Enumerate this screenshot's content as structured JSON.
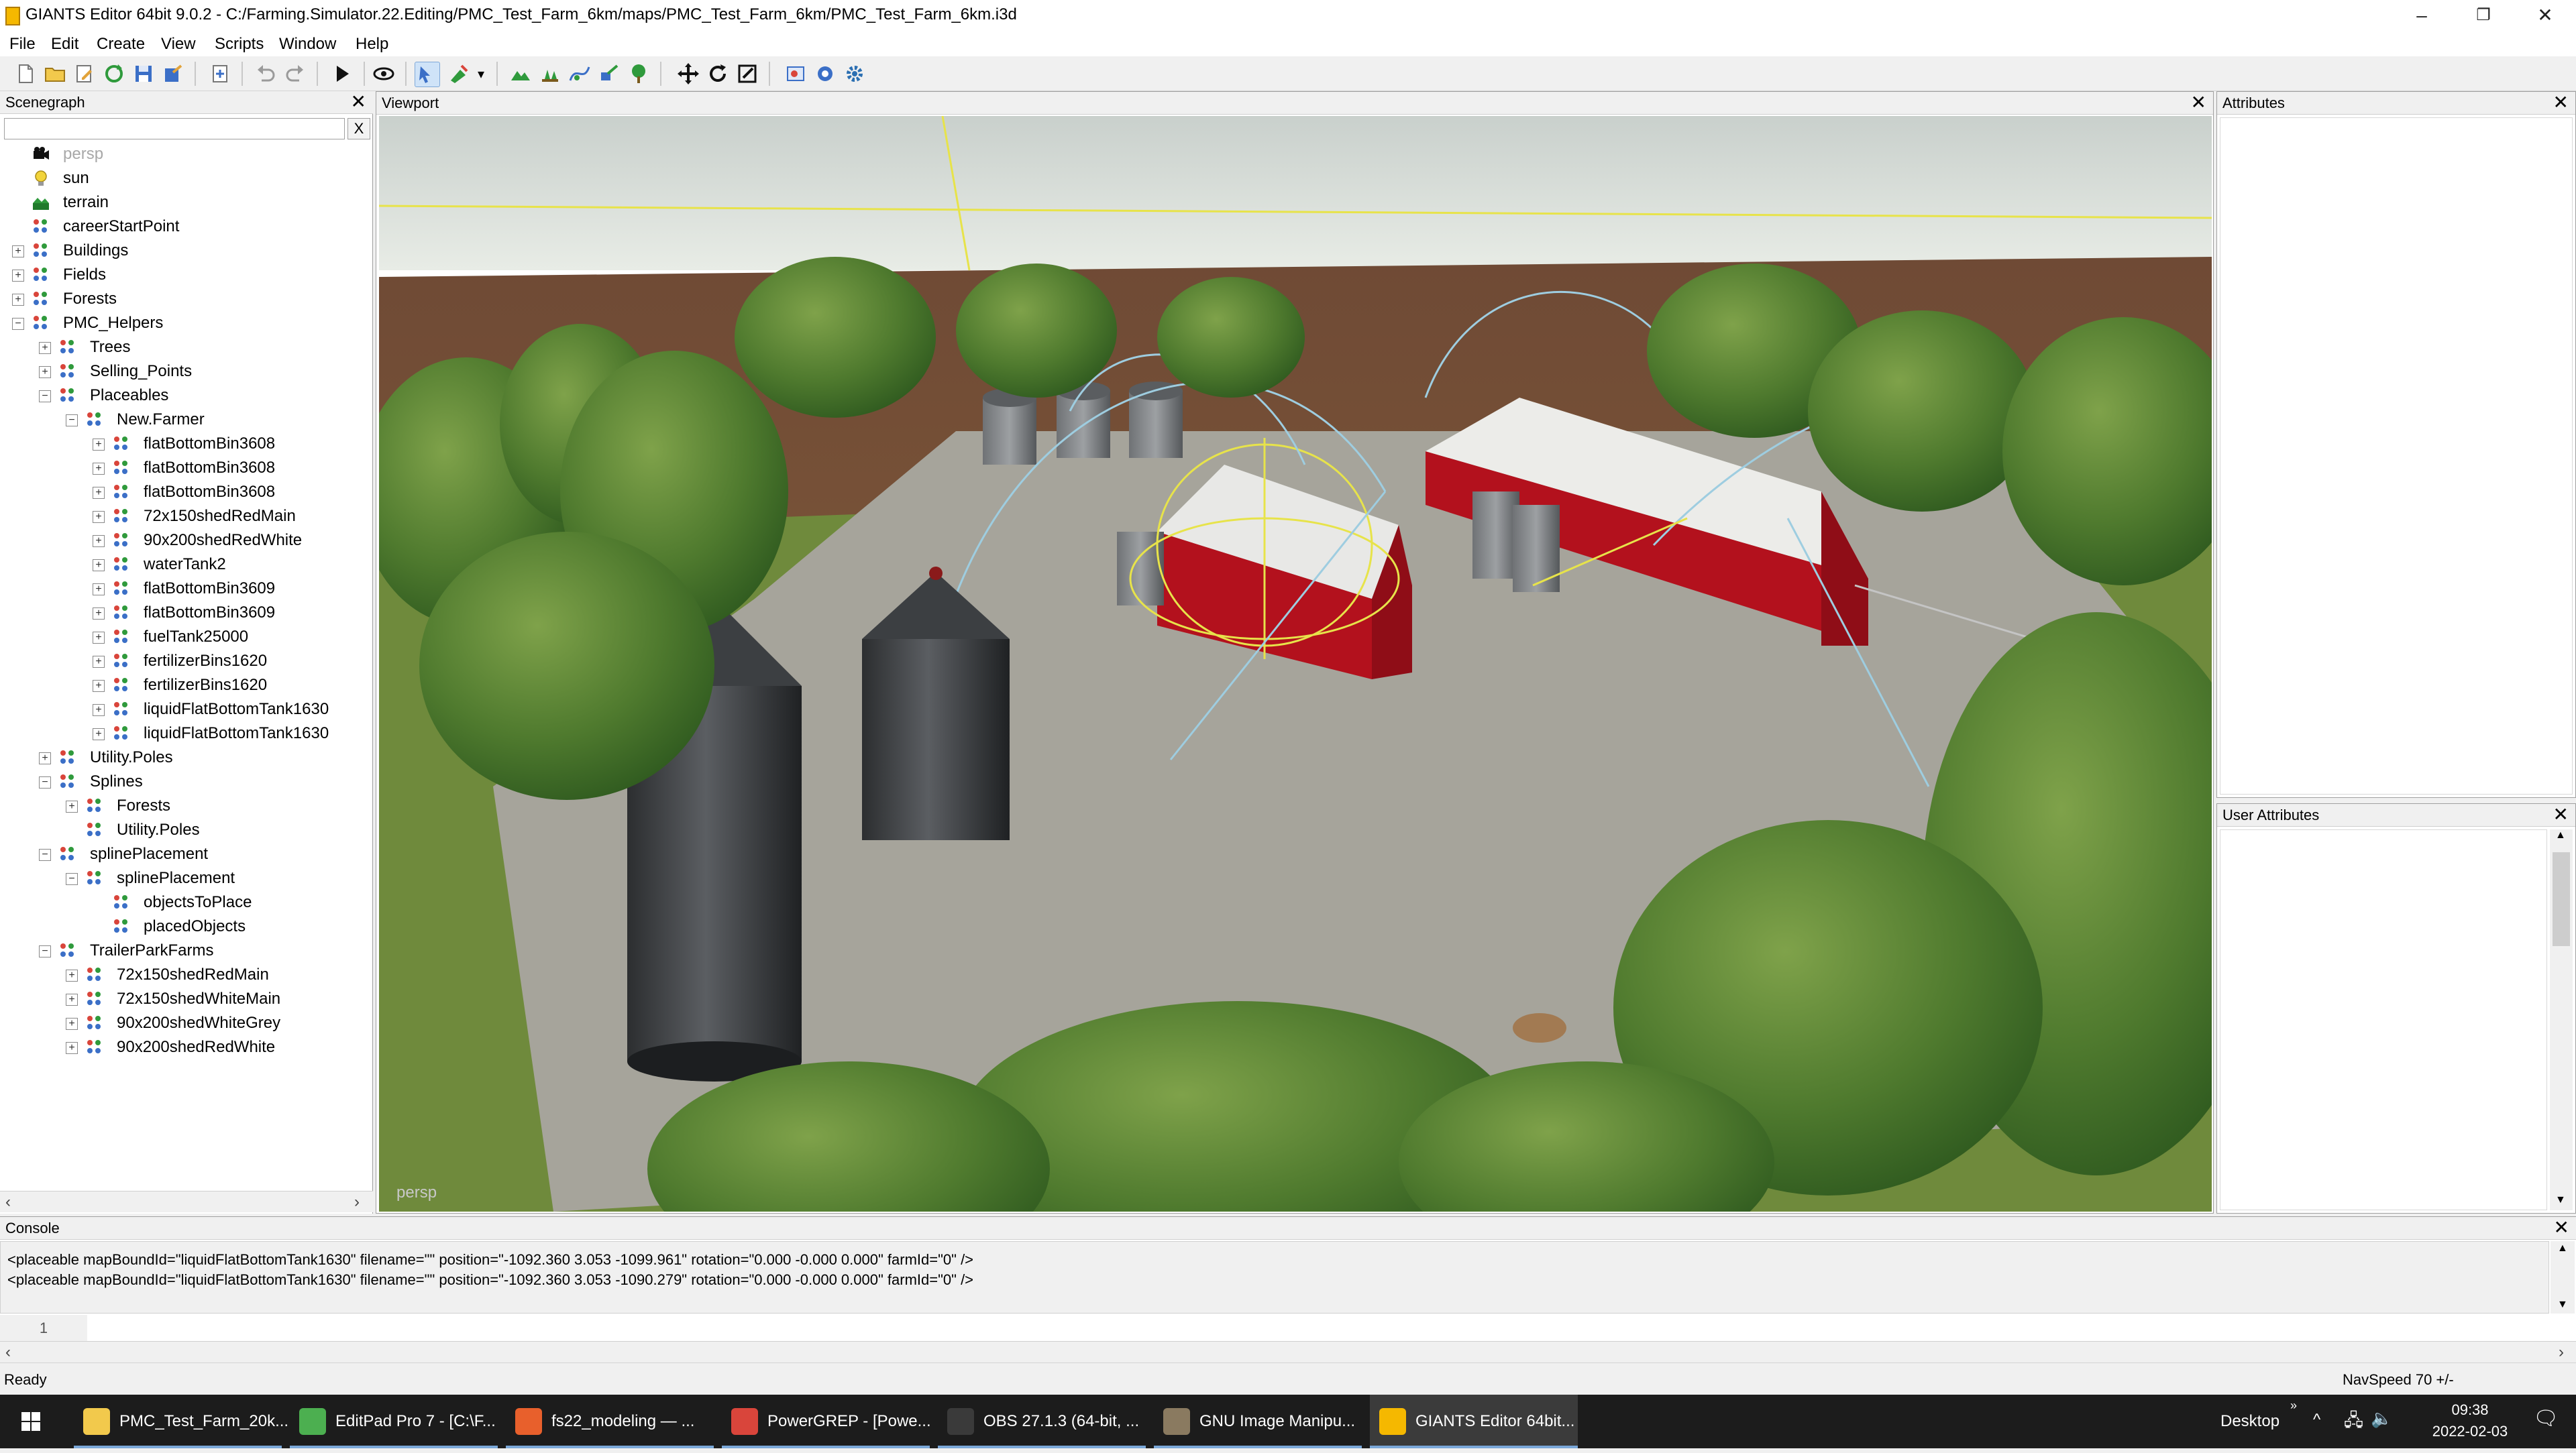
{
  "window": {
    "title": "GIANTS Editor 64bit 9.0.2 - C:/Farming.Simulator.22.Editing/PMC_Test_Farm_6km/maps/PMC_Test_Farm_6km/PMC_Test_Farm_6km.i3d",
    "minimize": "–",
    "maximize": "❐",
    "close": "✕"
  },
  "menu": [
    "File",
    "Edit",
    "Create",
    "View",
    "Scripts",
    "Window",
    "Help"
  ],
  "scenegraph": {
    "title": "Scenegraph",
    "close": "✕",
    "filter_value": "",
    "filter_clear": "X",
    "nodes": [
      {
        "label": "persp",
        "depth": 0,
        "expander": "",
        "icon": "camera-icon",
        "dim": true
      },
      {
        "label": "sun",
        "depth": 0,
        "expander": "",
        "icon": "light-icon"
      },
      {
        "label": "terrain",
        "depth": 0,
        "expander": "",
        "icon": "terrain-icon"
      },
      {
        "label": "careerStartPoint",
        "depth": 0,
        "expander": "",
        "icon": "transform-group-icon"
      },
      {
        "label": "Buildings",
        "depth": 0,
        "expander": "+",
        "icon": "transform-group-icon"
      },
      {
        "label": "Fields",
        "depth": 0,
        "expander": "+",
        "icon": "transform-group-icon"
      },
      {
        "label": "Forests",
        "depth": 0,
        "expander": "+",
        "icon": "transform-group-icon"
      },
      {
        "label": "PMC_Helpers",
        "depth": 0,
        "expander": "−",
        "icon": "transform-group-icon"
      },
      {
        "label": "Trees",
        "depth": 1,
        "expander": "+",
        "icon": "transform-group-icon"
      },
      {
        "label": "Selling_Points",
        "depth": 1,
        "expander": "+",
        "icon": "transform-group-icon"
      },
      {
        "label": "Placeables",
        "depth": 1,
        "expander": "−",
        "icon": "transform-group-icon"
      },
      {
        "label": "New.Farmer",
        "depth": 2,
        "expander": "−",
        "icon": "transform-group-icon"
      },
      {
        "label": "flatBottomBin3608",
        "depth": 3,
        "expander": "+",
        "icon": "transform-group-icon"
      },
      {
        "label": "flatBottomBin3608",
        "depth": 3,
        "expander": "+",
        "icon": "transform-group-icon"
      },
      {
        "label": "flatBottomBin3608",
        "depth": 3,
        "expander": "+",
        "icon": "transform-group-icon"
      },
      {
        "label": "72x150shedRedMain",
        "depth": 3,
        "expander": "+",
        "icon": "transform-group-icon"
      },
      {
        "label": "90x200shedRedWhite",
        "depth": 3,
        "expander": "+",
        "icon": "transform-group-icon"
      },
      {
        "label": "waterTank2",
        "depth": 3,
        "expander": "+",
        "icon": "transform-group-icon"
      },
      {
        "label": "flatBottomBin3609",
        "depth": 3,
        "expander": "+",
        "icon": "transform-group-icon"
      },
      {
        "label": "flatBottomBin3609",
        "depth": 3,
        "expander": "+",
        "icon": "transform-group-icon"
      },
      {
        "label": "fuelTank25000",
        "depth": 3,
        "expander": "+",
        "icon": "transform-group-icon"
      },
      {
        "label": "fertilizerBins1620",
        "depth": 3,
        "expander": "+",
        "icon": "transform-group-icon"
      },
      {
        "label": "fertilizerBins1620",
        "depth": 3,
        "expander": "+",
        "icon": "transform-group-icon"
      },
      {
        "label": "liquidFlatBottomTank1630",
        "depth": 3,
        "expander": "+",
        "icon": "transform-group-icon"
      },
      {
        "label": "liquidFlatBottomTank1630",
        "depth": 3,
        "expander": "+",
        "icon": "transform-group-icon"
      },
      {
        "label": "Utility.Poles",
        "depth": 1,
        "expander": "+",
        "icon": "transform-group-icon"
      },
      {
        "label": "Splines",
        "depth": 1,
        "expander": "−",
        "icon": "transform-group-icon"
      },
      {
        "label": "Forests",
        "depth": 2,
        "expander": "+",
        "icon": "transform-group-icon"
      },
      {
        "label": "Utility.Poles",
        "depth": 2,
        "expander": "",
        "icon": "transform-group-icon"
      },
      {
        "label": "splinePlacement",
        "depth": 1,
        "expander": "−",
        "icon": "transform-group-icon"
      },
      {
        "label": "splinePlacement",
        "depth": 2,
        "expander": "−",
        "icon": "transform-group-icon"
      },
      {
        "label": "objectsToPlace",
        "depth": 3,
        "expander": "",
        "icon": "transform-group-icon"
      },
      {
        "label": "placedObjects",
        "depth": 3,
        "expander": "",
        "icon": "transform-group-icon"
      },
      {
        "label": "TrailerParkFarms",
        "depth": 1,
        "expander": "−",
        "icon": "transform-group-icon"
      },
      {
        "label": "72x150shedRedMain",
        "depth": 2,
        "expander": "+",
        "icon": "transform-group-icon"
      },
      {
        "label": "72x150shedWhiteMain",
        "depth": 2,
        "expander": "+",
        "icon": "transform-group-icon"
      },
      {
        "label": "90x200shedWhiteGrey",
        "depth": 2,
        "expander": "+",
        "icon": "transform-group-icon"
      },
      {
        "label": "90x200shedRedWhite",
        "depth": 2,
        "expander": "+",
        "icon": "transform-group-icon"
      }
    ],
    "scroll_left": "‹",
    "scroll_right": "›"
  },
  "viewport": {
    "title": "Viewport",
    "close": "✕",
    "camera_label": "persp"
  },
  "attributes": {
    "title": "Attributes",
    "close": "✕"
  },
  "user_attributes": {
    "title": "User Attributes",
    "close": "✕",
    "scroll_up": "▲",
    "scroll_down": "▼"
  },
  "console": {
    "title": "Console",
    "close": "✕",
    "lines": [
      "<placeable mapBoundId=\"liquidFlatBottomTank1630\" filename=\"\" position=\"-1092.360 3.053 -1099.961\" rotation=\"0.000 -0.000 0.000\" farmId=\"0\" />",
      "<placeable mapBoundId=\"liquidFlatBottomTank1630\" filename=\"\" position=\"-1092.360 3.053 -1090.279\" rotation=\"0.000 -0.000 0.000\" farmId=\"0\" />"
    ],
    "input_line_number": "1",
    "input_value": "",
    "scroll_up": "▲",
    "scroll_down": "▼"
  },
  "bottom_scroll": {
    "left": "‹",
    "right": "›"
  },
  "status": {
    "left": "Ready",
    "right": "NavSpeed 70 +/-"
  },
  "taskbar": {
    "start_icon": "windows-logo-icon",
    "tasks": [
      {
        "label": "PMC_Test_Farm_20k...",
        "icon": "folder-icon",
        "color": "#f2c94c",
        "active": false
      },
      {
        "label": "EditPad Pro 7 - [C:\\F...",
        "icon": "editpad-icon",
        "color": "#4caf50",
        "active": false
      },
      {
        "label": "fs22_modeling — ...",
        "icon": "firefox-icon",
        "color": "#e8602c",
        "active": false
      },
      {
        "label": "PowerGREP - [Powe...",
        "icon": "powergrep-icon",
        "color": "#d9453b",
        "active": false
      },
      {
        "label": "OBS 27.1.3 (64-bit, ...",
        "icon": "obs-icon",
        "color": "#3a3a3a",
        "active": false
      },
      {
        "label": "GNU Image Manipu...",
        "icon": "gimp-icon",
        "color": "#8a7a60",
        "active": false
      },
      {
        "label": "GIANTS Editor 64bit...",
        "icon": "giants-editor-icon",
        "color": "#f5b800",
        "active": true
      }
    ],
    "desktop_label": "Desktop",
    "time": "09:38",
    "date": "2022-02-03"
  },
  "colors": {
    "selection": "#cfe3f8",
    "accent": "#7aa7d8",
    "shed_red": "#b3111d"
  }
}
